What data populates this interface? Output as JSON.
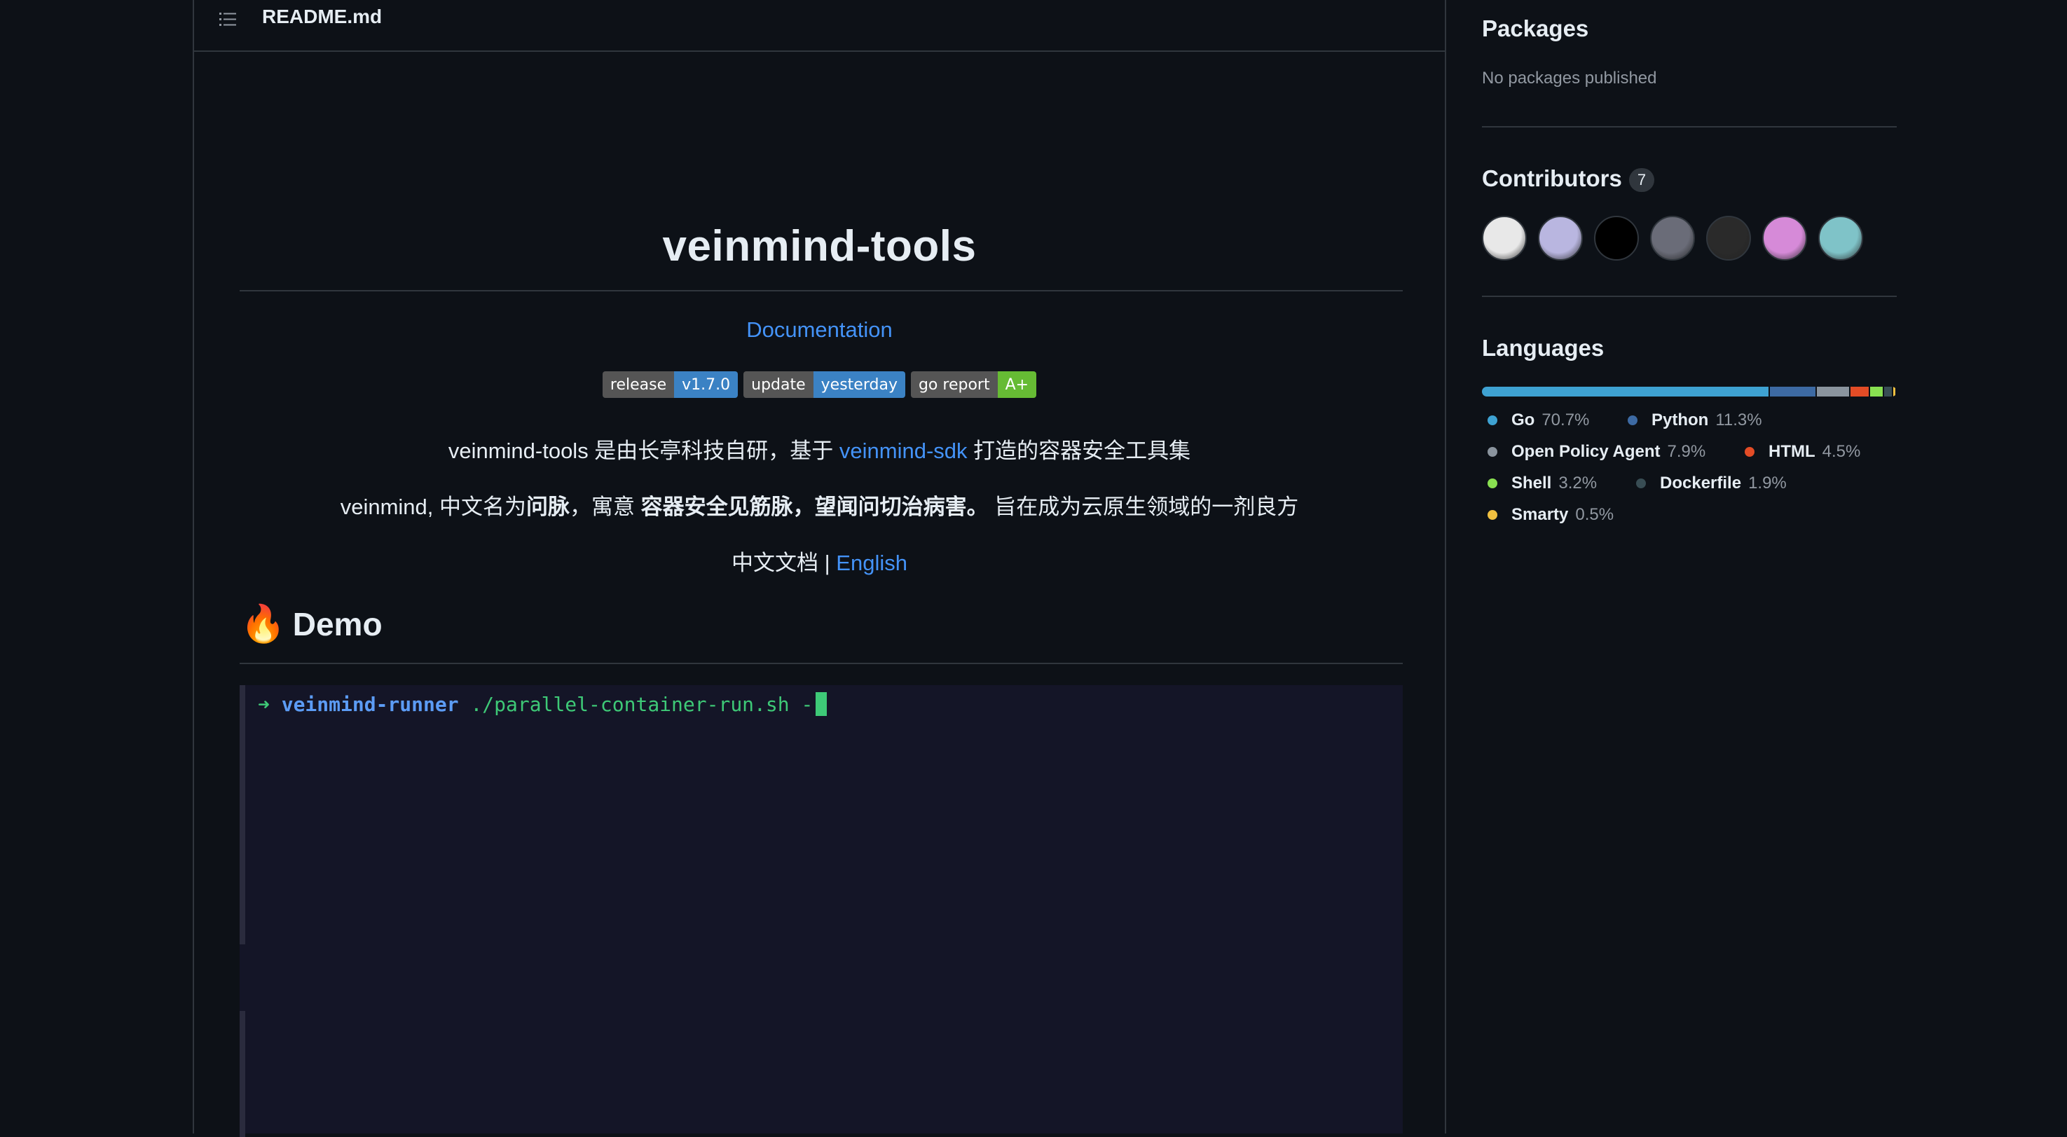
{
  "readme": {
    "filename": "README.md",
    "title": "veinmind-tools",
    "docs_link": "Documentation",
    "badges": [
      {
        "key": "release",
        "value": "v1.7.0"
      },
      {
        "key": "update",
        "value": "yesterday"
      },
      {
        "key": "go report",
        "value": "A+"
      }
    ],
    "line1": {
      "pre": "veinmind-tools 是由长亭科技自研，基于 ",
      "link": "veinmind-sdk",
      "post": " 打造的容器安全工具集"
    },
    "line2": {
      "pre": "veinmind, 中文名为",
      "bold1": "问脉",
      "mid": "，寓意 ",
      "bold2": "容器安全见筋脉，望闻问切治病害。",
      "post": " 旨在成为云原生领域的一剂良方"
    },
    "line3": {
      "pre": "中文文档 | ",
      "link": "English"
    },
    "demo_heading": "Demo",
    "demo_icon": "fire-emoji",
    "terminal": {
      "arrow": "➜",
      "command": "veinmind-runner",
      "argument": " ./parallel-container-run.sh -"
    }
  },
  "sidebar": {
    "packages": {
      "title": "Packages",
      "empty_text": "No packages published"
    },
    "contributors": {
      "title": "Contributors",
      "count": "7",
      "avatars": [
        "#e8e8e8",
        "#b9b6e0",
        "#000000",
        "#6a6c78",
        "#2a2a2a",
        "#d68ad8",
        "#7fc3c8"
      ]
    },
    "languages": {
      "title": "Languages",
      "items": [
        {
          "name": "Go",
          "percent": "70.7%",
          "value": 70.7,
          "color": "#3ea2d2"
        },
        {
          "name": "Python",
          "percent": "11.3%",
          "value": 11.3,
          "color": "#3d6aa3"
        },
        {
          "name": "Open Policy Agent",
          "percent": "7.9%",
          "value": 7.9,
          "color": "#8a949e"
        },
        {
          "name": "HTML",
          "percent": "4.5%",
          "value": 4.5,
          "color": "#e34c26"
        },
        {
          "name": "Shell",
          "percent": "3.2%",
          "value": 3.2,
          "color": "#89e051"
        },
        {
          "name": "Dockerfile",
          "percent": "1.9%",
          "value": 1.9,
          "color": "#384d54"
        },
        {
          "name": "Smarty",
          "percent": "0.5%",
          "value": 0.5,
          "color": "#f0c040"
        }
      ]
    }
  }
}
